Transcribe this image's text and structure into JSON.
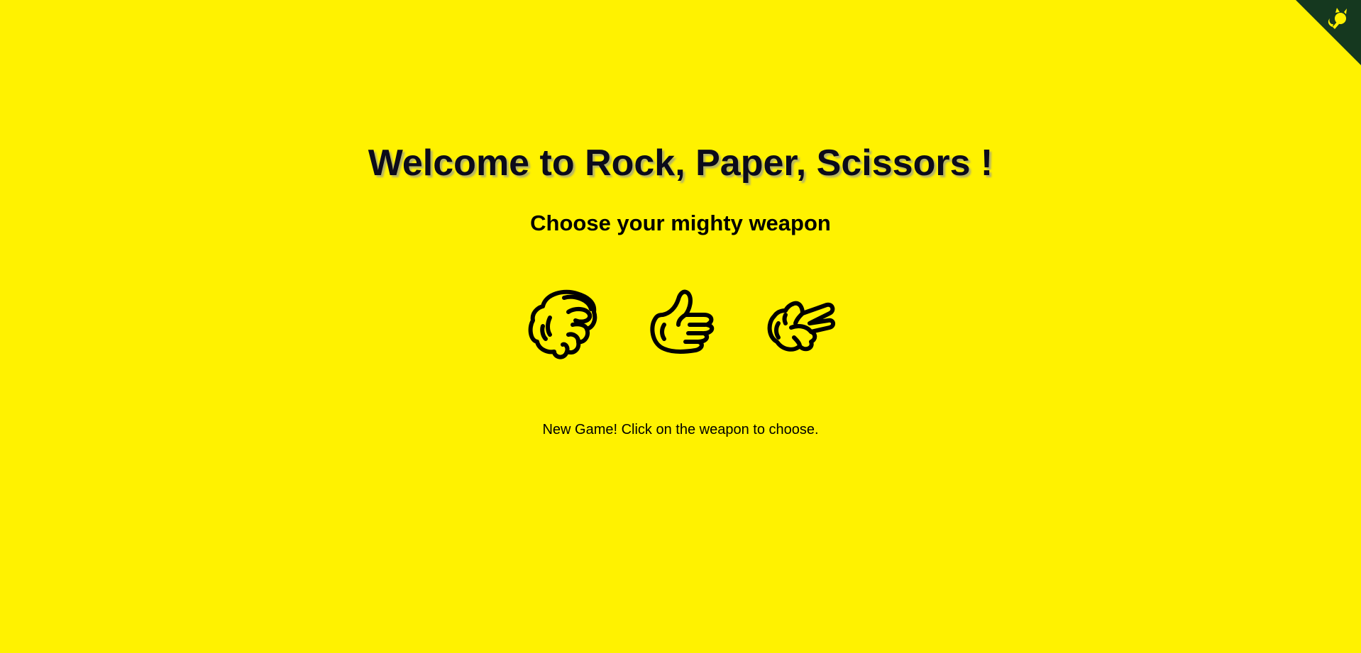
{
  "page": {
    "background_color": "#fff200",
    "corner_color": "#15381f"
  },
  "header": {
    "title": "Welcome to Rock, Paper, Scissors !",
    "subtitle": "Choose your mighty weapon"
  },
  "weapons": [
    {
      "id": "rock",
      "icon": "rock-hand-icon"
    },
    {
      "id": "paper",
      "icon": "paper-hand-icon"
    },
    {
      "id": "scissors",
      "icon": "scissors-hand-icon"
    }
  ],
  "status": {
    "message": "New Game! Click on the weapon to choose."
  },
  "corner_link": {
    "icon": "github-octocat-icon"
  }
}
